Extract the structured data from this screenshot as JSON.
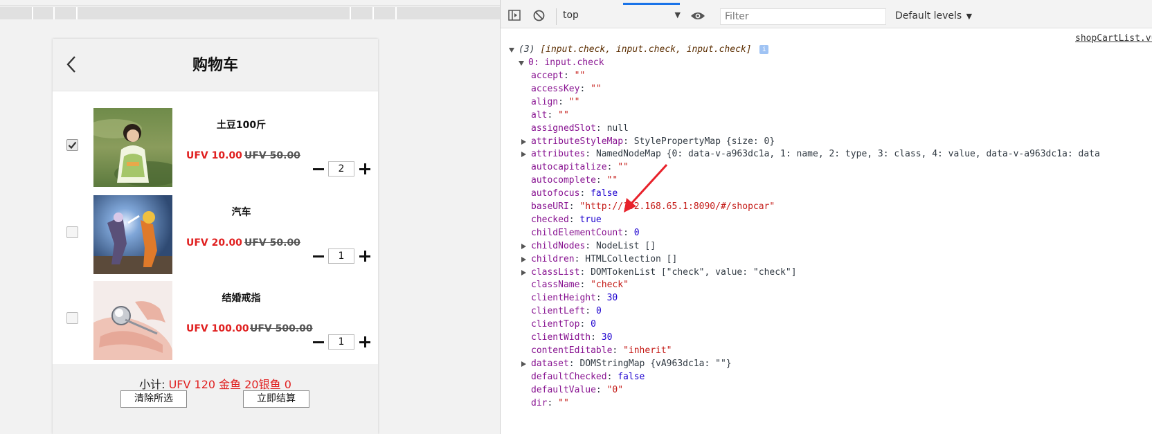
{
  "cart": {
    "title": "购物车",
    "items": [
      {
        "name": "土豆100斤",
        "price": "UFV 10.00",
        "old_price": "UFV 50.00",
        "qty": "2",
        "checked": true
      },
      {
        "name": "汽车",
        "price": "UFV 20.00",
        "old_price": "UFV 50.00",
        "qty": "1",
        "checked": false
      },
      {
        "name": "结婚戒指",
        "price": "UFV 100.00",
        "old_price": "UFV 500.00",
        "qty": "1",
        "checked": false
      }
    ],
    "subtotal_label": "小计:",
    "subtotal_value": "UFV 120 金鱼 20银鱼 0",
    "clear_button": "清除所选",
    "checkout_button": "立即结算"
  },
  "devtools": {
    "context": "top",
    "filter_placeholder": "Filter",
    "levels": "Default levels",
    "source_link": "shopCartList.vue",
    "summary": {
      "count": "(3)",
      "items": "[input.check, input.check, input.check]"
    },
    "node": "0: input.check",
    "props": [
      {
        "key": "accept",
        "val": "\"\"",
        "type": "s"
      },
      {
        "key": "accessKey",
        "val": "\"\"",
        "type": "s"
      },
      {
        "key": "align",
        "val": "\"\"",
        "type": "s"
      },
      {
        "key": "alt",
        "val": "\"\"",
        "type": "s"
      },
      {
        "key": "assignedSlot",
        "val": "null",
        "type": "g"
      },
      {
        "key": "attributeStyleMap",
        "val": "StylePropertyMap {size: 0}",
        "type": "o",
        "expand": true
      },
      {
        "key": "attributes",
        "val": "NamedNodeMap {0: data-v-a963dc1a, 1: name, 2: type, 3: class, 4: value, data-v-a963dc1a: data",
        "type": "o",
        "expand": true
      },
      {
        "key": "autocapitalize",
        "val": "\"\"",
        "type": "s"
      },
      {
        "key": "autocomplete",
        "val": "\"\"",
        "type": "s"
      },
      {
        "key": "autofocus",
        "val": "false",
        "type": "b"
      },
      {
        "key": "baseURI",
        "val": "\"http://192.168.65.1:8090/#/shopcar\"",
        "type": "s"
      },
      {
        "key": "checked",
        "val": "true",
        "type": "b"
      },
      {
        "key": "childElementCount",
        "val": "0",
        "type": "n"
      },
      {
        "key": "childNodes",
        "val": "NodeList []",
        "type": "o",
        "expand": true
      },
      {
        "key": "children",
        "val": "HTMLCollection []",
        "type": "o",
        "expand": true
      },
      {
        "key": "classList",
        "val": "DOMTokenList [\"check\", value: \"check\"]",
        "type": "o",
        "expand": true
      },
      {
        "key": "className",
        "val": "\"check\"",
        "type": "s"
      },
      {
        "key": "clientHeight",
        "val": "30",
        "type": "n"
      },
      {
        "key": "clientLeft",
        "val": "0",
        "type": "n"
      },
      {
        "key": "clientTop",
        "val": "0",
        "type": "n"
      },
      {
        "key": "clientWidth",
        "val": "30",
        "type": "n"
      },
      {
        "key": "contentEditable",
        "val": "\"inherit\"",
        "type": "s"
      },
      {
        "key": "dataset",
        "val": "DOMStringMap {vA963dc1a: \"\"}",
        "type": "o",
        "expand": true
      },
      {
        "key": "defaultChecked",
        "val": "false",
        "type": "b"
      },
      {
        "key": "defaultValue",
        "val": "\"0\"",
        "type": "s"
      },
      {
        "key": "dir",
        "val": "\"\"",
        "type": "s"
      }
    ],
    "colors": {
      "key": "#881391",
      "string": "#c41a16",
      "number": "#1c00cf",
      "accent": "#1a73e8",
      "annotation": "#e8212a"
    }
  }
}
